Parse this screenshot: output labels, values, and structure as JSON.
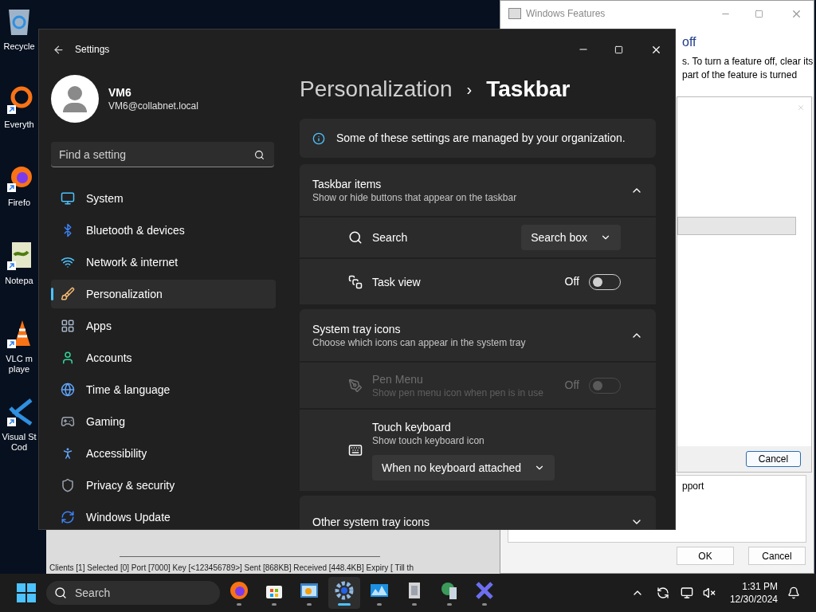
{
  "desktop_icons": [
    {
      "lines": [
        "Recycle"
      ]
    },
    {
      "lines": [
        "Everyth"
      ]
    },
    {
      "lines": [
        "Firefo"
      ]
    },
    {
      "lines": [
        "Notepa"
      ]
    },
    {
      "lines": [
        "VLC m",
        "playe"
      ]
    },
    {
      "lines": [
        "Visual St",
        "Cod"
      ]
    }
  ],
  "background_window": {
    "status_text": "Clients [1]  Selected [0]  Port [7000]  Key [<123456789>]  Sent [868KB]  Received [448.4KB]  Expiry [ Till th"
  },
  "features_window": {
    "title": "Windows Features",
    "heading": "off",
    "description_lines": [
      "s. To turn a feature off, clear its",
      "part of the feature is turned"
    ],
    "inner_dialog": {
      "button": "Cancel"
    },
    "partial_text": "pport",
    "buttons": [
      "OK",
      "Cancel"
    ]
  },
  "settings": {
    "title": "Settings",
    "user": {
      "name": "VM6",
      "email": "VM6@collabnet.local"
    },
    "search": {
      "placeholder": "Find a setting"
    },
    "nav": [
      {
        "label": "System",
        "selected": false
      },
      {
        "label": "Bluetooth & devices",
        "selected": false
      },
      {
        "label": "Network & internet",
        "selected": false
      },
      {
        "label": "Personalization",
        "selected": true
      },
      {
        "label": "Apps",
        "selected": false
      },
      {
        "label": "Accounts",
        "selected": false
      },
      {
        "label": "Time & language",
        "selected": false
      },
      {
        "label": "Gaming",
        "selected": false
      },
      {
        "label": "Accessibility",
        "selected": false
      },
      {
        "label": "Privacy & security",
        "selected": false
      },
      {
        "label": "Windows Update",
        "selected": false
      }
    ],
    "breadcrumb": [
      "Personalization",
      "Taskbar"
    ],
    "breadcrumb_separator": "›",
    "info": "Some of these settings are managed by your organization.",
    "sections": [
      {
        "title": "Taskbar items",
        "subtitle": "Show or hide buttons that appear on the taskbar",
        "expanded": true,
        "rows": [
          {
            "kind": "select",
            "label": "Search",
            "value": "Search box",
            "disabled": false
          },
          {
            "kind": "toggle",
            "label": "Task view",
            "state_text": "Off",
            "on": false,
            "disabled": false
          }
        ]
      },
      {
        "title": "System tray icons",
        "subtitle": "Choose which icons can appear in the system tray",
        "expanded": true,
        "rows": [
          {
            "kind": "toggle",
            "label": "Pen Menu",
            "description": "Show pen menu icon when pen is in use",
            "state_text": "Off",
            "on": false,
            "disabled": true
          },
          {
            "kind": "stacked",
            "label": "Touch keyboard",
            "description": "Show touch keyboard icon",
            "value": "When no keyboard attached",
            "disabled": false
          }
        ]
      },
      {
        "title": "Other system tray icons",
        "expanded": false
      }
    ]
  },
  "taskbar": {
    "search": {
      "placeholder": "Search"
    },
    "apps": [
      {
        "selected": false
      },
      {
        "selected": false
      },
      {
        "selected": false
      },
      {
        "selected": true
      },
      {
        "selected": false
      },
      {
        "selected": false
      },
      {
        "selected": false
      },
      {
        "selected": false
      }
    ],
    "time": "1:31 PM",
    "date": "12/30/2024"
  }
}
